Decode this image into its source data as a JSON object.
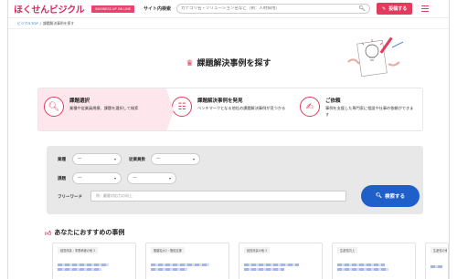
{
  "header": {
    "logo": "ほくせんビジクル",
    "badge": "BUSINESS UP ON LINE",
    "site_search_label": "サイト内検索",
    "search_placeholder": "カテゴリ名・ソリューション名など（例：人材採用）",
    "post_button": "投稿する"
  },
  "breadcrumb": {
    "home": "ビジクルTOP",
    "separator": "/",
    "current": "課題解決事例を探す"
  },
  "hero": {
    "title": "課題解決事例を探す"
  },
  "steps": [
    {
      "title": "課題選択",
      "desc": "業種や従業員規模、課題を選択して検索"
    },
    {
      "title": "課題解決事例を発見",
      "desc": "ベンチマークとなる他社の課題解決事例が見つかる"
    },
    {
      "title": "ご依頼",
      "desc": "事例を支援した専門家に相談や仕事の依頼ができます"
    }
  ],
  "filter": {
    "industry_label": "業種",
    "industry_value": "—",
    "employees_label": "従業員数",
    "employees_value": "—",
    "issue_label": "課題",
    "issue_value": "—",
    "issue2_value": "—",
    "freeword_label": "フリーワード",
    "freeword_placeholder": "例：顧客対応力の向上",
    "search_button": "検索する"
  },
  "recommend": {
    "title": "あなたにおすすめの事例",
    "cards": [
      {
        "tag": "経営改善・事業承継の他 2"
      },
      {
        "tag": "販路拡大2・販促支援"
      },
      {
        "tag": "経営改善の他 3"
      },
      {
        "tag": "生産性向上"
      },
      {
        "tag": "生産性の他 3"
      }
    ]
  },
  "colors": {
    "accent": "#e23b5d",
    "primary_button": "#1f5fc9",
    "active_step_bg": "#fde7ed"
  }
}
